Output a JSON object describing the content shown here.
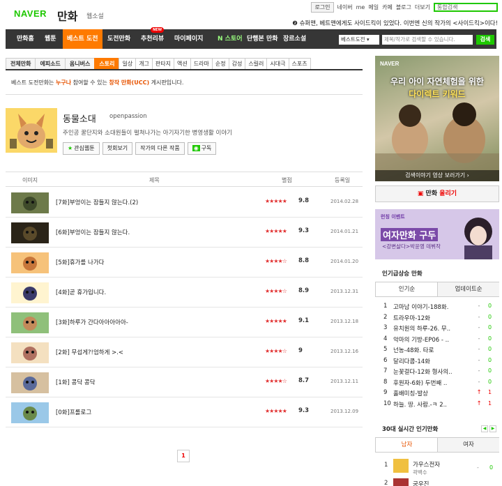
{
  "header": {
    "logo": "NAVER",
    "category": "만화",
    "sub": "웹소설",
    "gnb": [
      "로그인",
      "네이버",
      "me",
      "메일",
      "카페",
      "블로그",
      "더보기"
    ],
    "search_placeholder": "통합검색",
    "notice": "❷ 슈퍼맨, 베트맨에게도 사이드킥이 있었다. 이번엔 신의 작가의 <사이드킥>이다!"
  },
  "nav": {
    "items": [
      "만화홈",
      "웹툰",
      "베스트 도전",
      "도전만화",
      "추천리뷰",
      "마이페이지",
      "N 스토어",
      "단행본 만화",
      "장르소설"
    ],
    "new_tag": "NEW",
    "select": "베스트도전",
    "search_placeholder": "제목/작가로 검색할 수 있습니다.",
    "search_btn": "검색"
  },
  "tabs": [
    "전체만화",
    "에피소드",
    "옴니버스",
    "스토리",
    "일상",
    "개그",
    "판타지",
    "액션",
    "드라마",
    "순정",
    "감성",
    "스릴러",
    "시대극",
    "스포츠"
  ],
  "description": {
    "pre": "베스트 도전만화는 ",
    "hl1": "누구나",
    "mid": " 참여할 수 있는 ",
    "hl2": "창작 만화(UCC)",
    "post": " 게시판입니다."
  },
  "comic": {
    "title": "동물소대",
    "author": "openpassion",
    "desc": "주인공 꿀단지와 소대원들이 펼쳐나가는 아기자기한 병영생활 이야기",
    "buttons": [
      "관심웹툰",
      "첫회보기",
      "작가의 다른 작품",
      "구독"
    ]
  },
  "list": {
    "headers": [
      "이미지",
      "제목",
      "별점",
      "등록일"
    ],
    "rows": [
      {
        "title": "[7화]부엉이는 잠들지 않는다.(2)",
        "stars": "★★★★★",
        "score": "9.8",
        "date": "2014.02.28"
      },
      {
        "title": "[6화]부엉이는 잠들지 않는다.",
        "stars": "★★★★★",
        "score": "9.3",
        "date": "2014.01.21"
      },
      {
        "title": "[5화]휴가를 나가다",
        "stars": "★★★★☆",
        "score": "8.8",
        "date": "2014.01.20"
      },
      {
        "title": "[4화]곧 휴가입니다.",
        "stars": "★★★★☆",
        "score": "8.9",
        "date": "2013.12.31"
      },
      {
        "title": "[3화]하루가 간다아아아아아-",
        "stars": "★★★★★",
        "score": "9.1",
        "date": "2013.12.18"
      },
      {
        "title": "[2화] 무섭게?!엄하게 >.<",
        "stars": "★★★★☆",
        "score": "9",
        "date": "2013.12.16"
      },
      {
        "title": "[1화] 콩닥 콩닥",
        "stars": "★★★★☆",
        "score": "8.7",
        "date": "2013.12.11"
      },
      {
        "title": "[0화]프롤로그",
        "stars": "★★★★★",
        "score": "9.3",
        "date": "2013.12.09"
      }
    ]
  },
  "pager": "1",
  "ad1": {
    "brand": "NAVER",
    "line1": "우리 아이 자연체험을 위한",
    "line2": "다이렉트 키워드",
    "bar": "검색이야기 영상 보러가기 ›"
  },
  "upload": {
    "pre": "만화 ",
    "hl": "올리기"
  },
  "ad2": {
    "t1": "런칭 이벤트",
    "t2": "여자만화 구두",
    "t3": "<강변살다>박윤영 데뷔작"
  },
  "rising": {
    "title": "인기급상승 만화",
    "tabs": [
      "인기순",
      "업데이트순"
    ],
    "items": [
      {
        "n": "1",
        "t": "고마남 이야기-188화.",
        "d": "-",
        "c": "0"
      },
      {
        "n": "2",
        "t": "트라우마-12화",
        "d": "-",
        "c": "0"
      },
      {
        "n": "3",
        "t": "유치원의 하루-26. 무..",
        "d": "-",
        "c": "0"
      },
      {
        "n": "4",
        "t": "악마의 기방-EP06 - ..",
        "d": "-",
        "c": "0"
      },
      {
        "n": "5",
        "t": "넌농-48화. 타로",
        "d": "-",
        "c": "0"
      },
      {
        "n": "6",
        "t": "달리다콤-14화",
        "d": "-",
        "c": "0"
      },
      {
        "n": "7",
        "t": "눈꽃걸다-12화 형사의..",
        "d": "-",
        "c": "0"
      },
      {
        "n": "8",
        "t": "후원자-6화) 두번째 ..",
        "d": "-",
        "c": "0"
      },
      {
        "n": "9",
        "t": "홀배미칭-발상",
        "d": "↑",
        "c": "1"
      },
      {
        "n": "10",
        "t": "하늘. 땅. 사람.-ㅋ 2..",
        "d": "↑",
        "c": "1"
      }
    ]
  },
  "realtime": {
    "title": "30대 실시간 인기만화",
    "tabs": [
      "남자",
      "여자"
    ],
    "items": [
      {
        "n": "1",
        "t": "가우스전자",
        "a": "곽백수",
        "d": "-",
        "c": "0"
      },
      {
        "n": "2",
        "t": "궁우진",
        "a": ""
      }
    ]
  }
}
